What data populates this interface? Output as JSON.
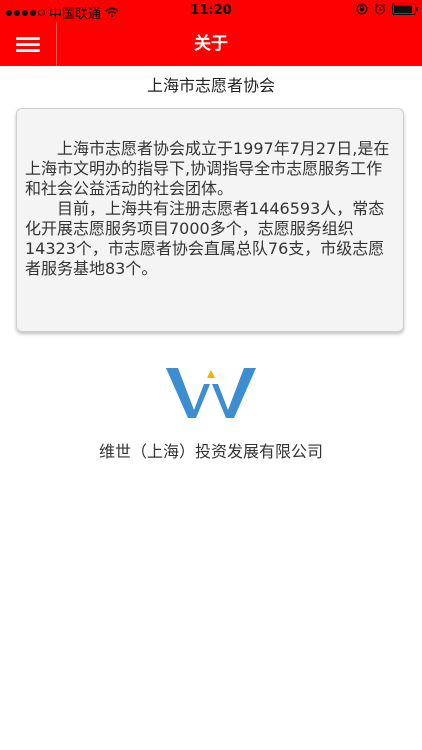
{
  "status_bar": {
    "carrier": "中国联通",
    "time": "11:20"
  },
  "nav": {
    "title": "关于",
    "menu_icon": "hamburger-menu-icon"
  },
  "about": {
    "org_title": "上海市志愿者协会",
    "paragraph1": "上海市志愿者协会成立于1997年7月27日,是在上海市文明办的指导下,协调指导全市志愿服务工作和社会公益活动的社会团体。",
    "paragraph2": "目前，上海共有注册志愿者1446593人，常态化开展志愿服务项目7000多个，志愿服务组织14323个，市志愿者协会直属总队76支，市级志愿者服务基地83个。"
  },
  "footer": {
    "logo_icon": "company-logo-w",
    "company_name": "维世（上海）投资发展有限公司"
  },
  "colors": {
    "navbar": "#ff0000",
    "logo_blue": "#3d8ed0",
    "logo_accent": "#f2b300"
  }
}
